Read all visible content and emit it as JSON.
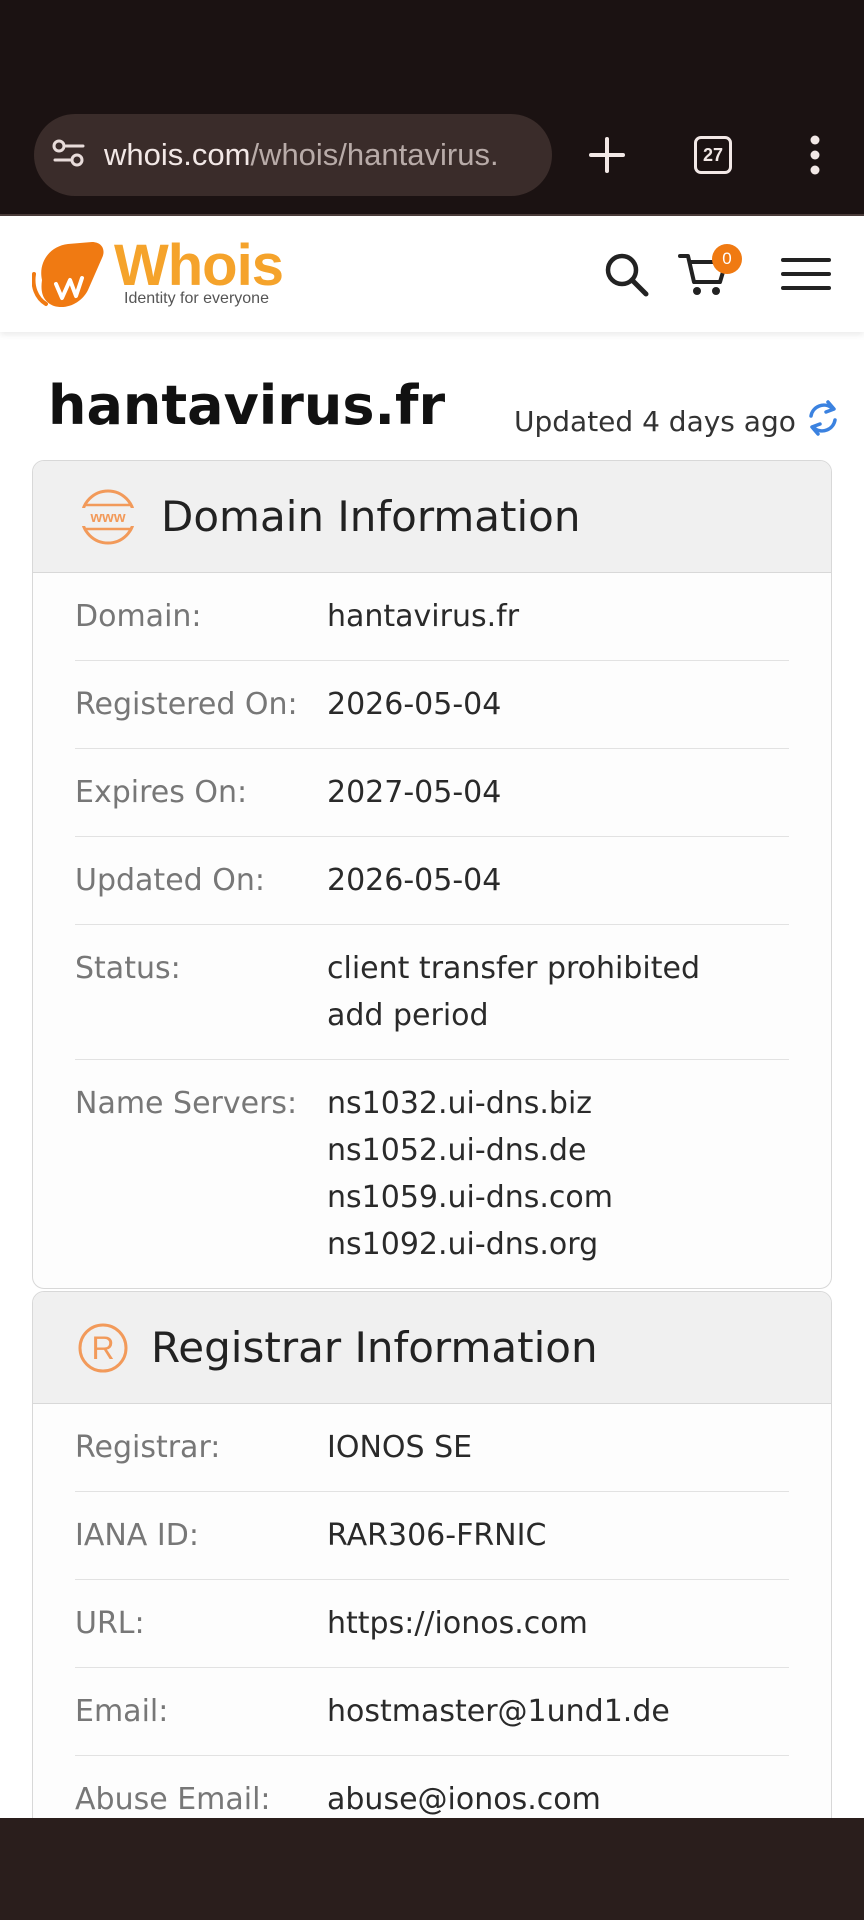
{
  "browser": {
    "url_host": "whois.com",
    "url_path": "/whois/hantavirus.",
    "tab_count": "27"
  },
  "header": {
    "logo_text": "Whois",
    "logo_tagline": "Identity for everyone",
    "cart_count": "0"
  },
  "page": {
    "domain_title": "hantavirus.fr",
    "updated_text": "Updated 4 days ago"
  },
  "domain_info": {
    "title": "Domain Information",
    "rows": [
      {
        "label": "Domain:",
        "values": [
          "hantavirus.fr"
        ]
      },
      {
        "label": "Registered On:",
        "values": [
          "2026-05-04"
        ]
      },
      {
        "label": "Expires On:",
        "values": [
          "2027-05-04"
        ]
      },
      {
        "label": "Updated On:",
        "values": [
          "2026-05-04"
        ]
      },
      {
        "label": "Status:",
        "values": [
          "client transfer prohibited",
          "add period"
        ]
      },
      {
        "label": "Name Servers:",
        "values": [
          "ns1032.ui-dns.biz",
          "ns1052.ui-dns.de",
          "ns1059.ui-dns.com",
          "ns1092.ui-dns.org"
        ]
      }
    ]
  },
  "registrar_info": {
    "title": "Registrar Information",
    "rows": [
      {
        "label": "Registrar:",
        "values": [
          "IONOS SE"
        ]
      },
      {
        "label": "IANA ID:",
        "values": [
          "RAR306-FRNIC"
        ]
      },
      {
        "label": "URL:",
        "values": [
          "https://ionos.com"
        ]
      },
      {
        "label": "Email:",
        "values": [
          "hostmaster@1und1.de"
        ]
      },
      {
        "label": "Abuse Email:",
        "values": [
          "abuse@ionos.com"
        ]
      }
    ]
  },
  "colors": {
    "accent_orange": "#f07a12",
    "logo_yellow": "#f5a32b",
    "refresh_blue": "#3b82e0"
  }
}
